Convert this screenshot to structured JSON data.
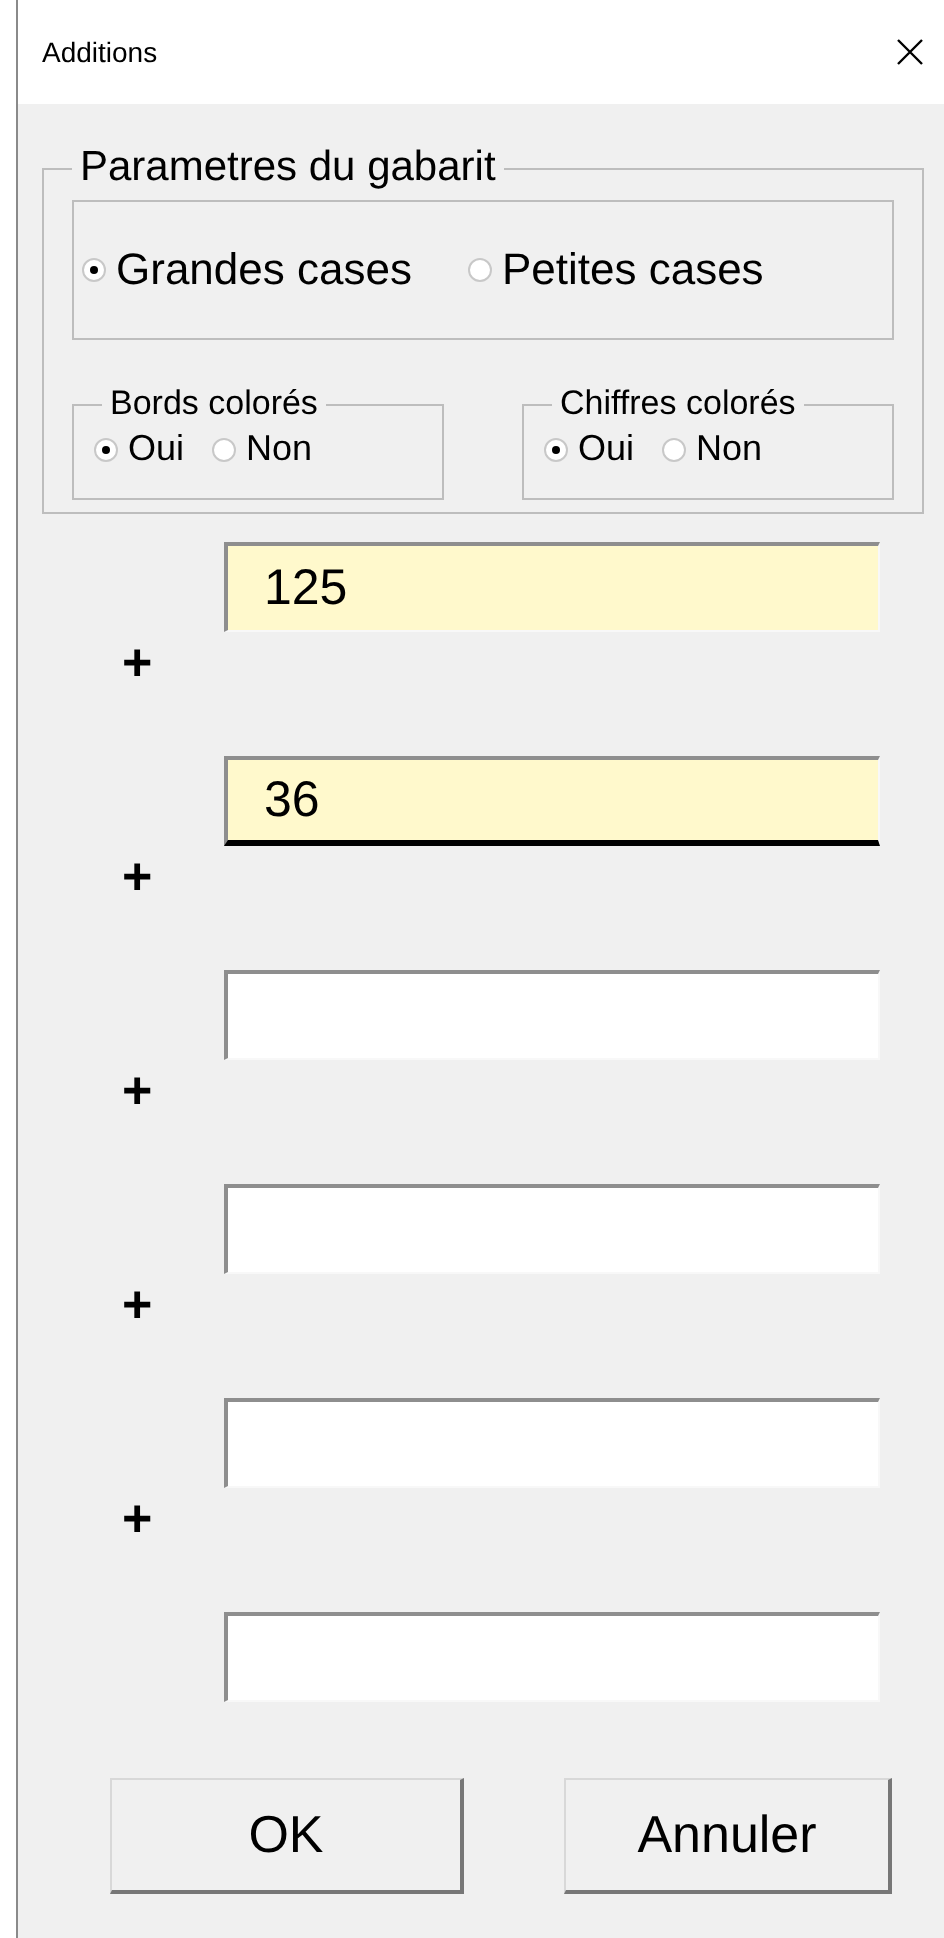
{
  "window": {
    "title": "Additions"
  },
  "template": {
    "legend": "Parametres du gabarit",
    "size_options": [
      {
        "label": "Grandes cases",
        "selected": true
      },
      {
        "label": "Petites cases",
        "selected": false
      }
    ],
    "groups": [
      {
        "legend": "Bords colorés",
        "options": [
          {
            "label": "Oui",
            "selected": true
          },
          {
            "label": "Non",
            "selected": false
          }
        ]
      },
      {
        "legend": "Chiffres colorés",
        "options": [
          {
            "label": "Oui",
            "selected": true
          },
          {
            "label": "Non",
            "selected": false
          }
        ]
      }
    ]
  },
  "addends": [
    {
      "value": "125",
      "highlighted": true,
      "focused": false
    },
    {
      "operator": "+",
      "value": "36",
      "highlighted": true,
      "focused": true
    },
    {
      "operator": "+",
      "highlighted": false,
      "focused": false
    },
    {
      "operator": "+",
      "highlighted": false,
      "focused": false
    },
    {
      "operator": "+",
      "highlighted": false,
      "focused": false
    },
    {
      "operator": "+",
      "highlighted": false,
      "focused": false
    }
  ],
  "buttons": [
    {
      "label": "OK",
      "kind": "ok"
    },
    {
      "label": "Annuler",
      "kind": "cancel"
    }
  ]
}
